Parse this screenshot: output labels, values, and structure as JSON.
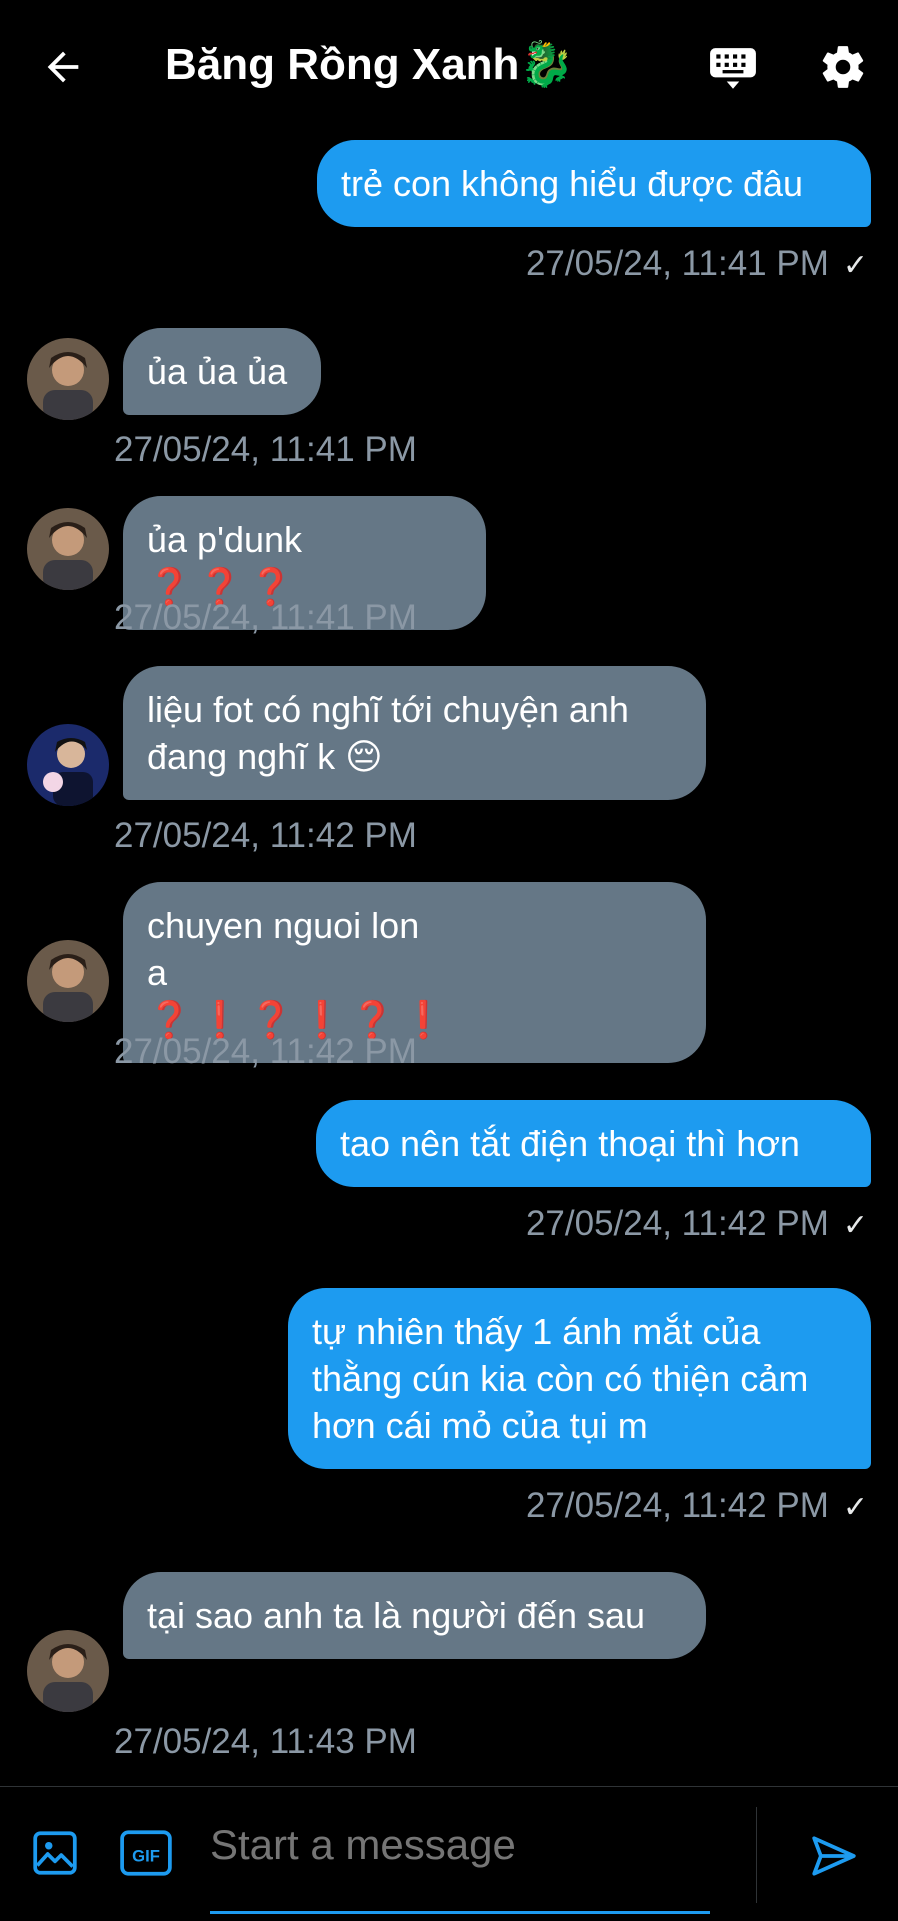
{
  "header": {
    "title": "Băng Rồng Xanh🐉"
  },
  "composer": {
    "placeholder": "Start a message"
  },
  "messages": [
    {
      "dir": "out",
      "text": "trẻ con không hiểu được đâu",
      "time": "27/05/24, 11:41 PM",
      "status": "✓"
    },
    {
      "dir": "in",
      "text": "ủa ủa ủa",
      "time": "27/05/24, 11:41 PM"
    },
    {
      "dir": "in",
      "text": "ủa p'dunk",
      "marks": "❓❓❓",
      "time": "27/05/24, 11:41 PM"
    },
    {
      "dir": "in",
      "text": "liệu fot có nghĩ tới chuyện anh đang nghĩ k 😔",
      "time": "27/05/24, 11:42 PM"
    },
    {
      "dir": "in",
      "text": "chuyen nguoi lon a",
      "marks": "❓❗❓❗❓❗",
      "time": "27/05/24, 11:42 PM"
    },
    {
      "dir": "out",
      "text": "tao nên tắt điện thoại thì hơn",
      "time": "27/05/24, 11:42 PM",
      "status": "✓"
    },
    {
      "dir": "out",
      "text": "tự nhiên thấy 1 ánh mắt của thằng cún kia còn có thiện cảm hơn cái mỏ của tụi m",
      "time": "27/05/24, 11:42 PM",
      "status": "✓"
    },
    {
      "dir": "in",
      "text": "tại sao anh ta là người đến sau",
      "time": "27/05/24, 11:43 PM"
    }
  ],
  "colors": {
    "outgoing": "#1d9bf0",
    "incoming": "#657786",
    "background": "#000000"
  },
  "icons": [
    "back-arrow-icon",
    "keyboard-icon",
    "gear-icon",
    "image-icon",
    "gif-icon",
    "send-icon"
  ]
}
